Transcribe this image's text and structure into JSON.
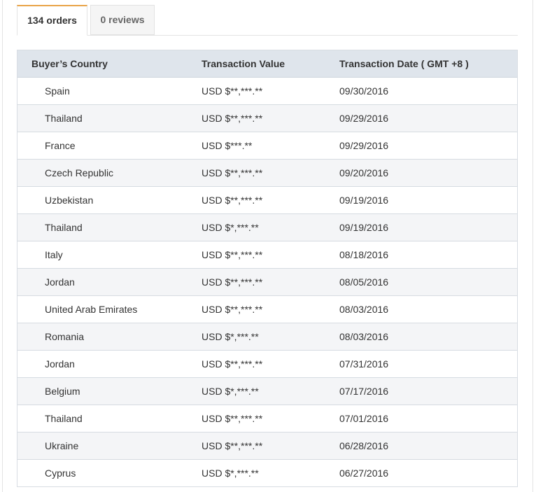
{
  "tabs": [
    {
      "label": "134 orders",
      "active": true
    },
    {
      "label": "0 reviews",
      "active": false
    }
  ],
  "table": {
    "headers": [
      "Buyer’s Country",
      "Transaction Value",
      "Transaction Date ( GMT +8 )"
    ],
    "rows": [
      {
        "country": "Spain",
        "flag": "flag-spain-icon",
        "value": "USD $**,***.**",
        "date": "09/30/2016"
      },
      {
        "country": "Thailand",
        "flag": "flag-thailand-icon",
        "value": "USD $**,***.**",
        "date": "09/29/2016"
      },
      {
        "country": "France",
        "flag": "flag-france-icon",
        "value": "USD $***.**",
        "date": "09/29/2016"
      },
      {
        "country": "Czech Republic",
        "flag": "flag-czech-republic-icon",
        "value": "USD $**,***.**",
        "date": "09/20/2016"
      },
      {
        "country": "Uzbekistan",
        "flag": "flag-uzbekistan-icon",
        "value": "USD $**,***.**",
        "date": "09/19/2016"
      },
      {
        "country": "Thailand",
        "flag": "flag-thailand-icon",
        "value": "USD $*,***.**",
        "date": "09/19/2016"
      },
      {
        "country": "Italy",
        "flag": "flag-italy-icon",
        "value": "USD $**,***.**",
        "date": "08/18/2016"
      },
      {
        "country": "Jordan",
        "flag": "flag-jordan-icon",
        "value": "USD $**,***.**",
        "date": "08/05/2016"
      },
      {
        "country": "United Arab Emirates",
        "flag": "flag-uae-icon",
        "value": "USD $**,***.**",
        "date": "08/03/2016"
      },
      {
        "country": "Romania",
        "flag": "flag-romania-icon",
        "value": "USD $*,***.**",
        "date": "08/03/2016"
      },
      {
        "country": "Jordan",
        "flag": "flag-jordan-icon",
        "value": "USD $**,***.**",
        "date": "07/31/2016"
      },
      {
        "country": "Belgium",
        "flag": "flag-belgium-icon",
        "value": "USD $*,***.**",
        "date": "07/17/2016"
      },
      {
        "country": "Thailand",
        "flag": "flag-thailand-icon",
        "value": "USD $**,***.**",
        "date": "07/01/2016"
      },
      {
        "country": "Ukraine",
        "flag": "flag-ukraine-icon",
        "value": "USD $**,***.**",
        "date": "06/28/2016"
      },
      {
        "country": "Cyprus",
        "flag": "flag-cyprus-icon",
        "value": "USD $*,***.**",
        "date": "06/27/2016"
      }
    ]
  },
  "colors": {
    "tab_accent": "#e9a448",
    "header_bg": "#dfe5ec",
    "row_alt_bg": "#f4f5f7"
  }
}
